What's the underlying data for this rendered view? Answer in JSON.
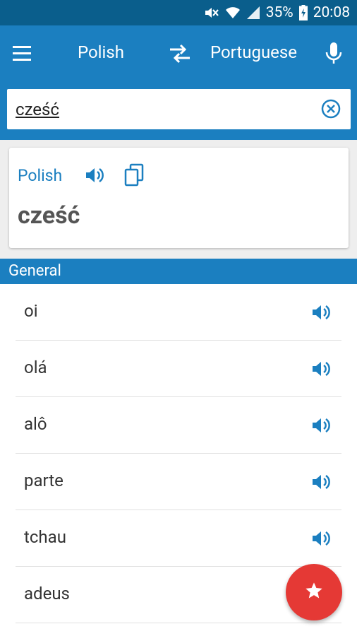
{
  "status_bar": {
    "battery_percent": "35%",
    "time": "20:08",
    "icons": [
      "mute-icon",
      "wifi-icon",
      "signal-icon",
      "battery-charging-icon"
    ]
  },
  "app_bar": {
    "menu_icon": "hamburger-menu-icon",
    "source_language": "Polish",
    "swap_icon": "swap-icon",
    "target_language": "Portuguese",
    "mic_icon": "mic-icon"
  },
  "search": {
    "value": "cześć",
    "clear_icon": "clear-circle-icon"
  },
  "card": {
    "language": "Polish",
    "speak_icon": "speaker-icon",
    "copy_icon": "copy-icon",
    "word": "cześć"
  },
  "section": {
    "title": "General"
  },
  "results": [
    {
      "text": "oi",
      "has_audio": true
    },
    {
      "text": "olá",
      "has_audio": true
    },
    {
      "text": "alô",
      "has_audio": true
    },
    {
      "text": "parte",
      "has_audio": true
    },
    {
      "text": "tchau",
      "has_audio": true
    },
    {
      "text": "adeus",
      "has_audio": false
    }
  ],
  "fab": {
    "icon": "star-icon"
  },
  "colors": {
    "primary": "#1b7fc0",
    "status_bar": "#0a5e8c",
    "fab": "#e53935"
  }
}
